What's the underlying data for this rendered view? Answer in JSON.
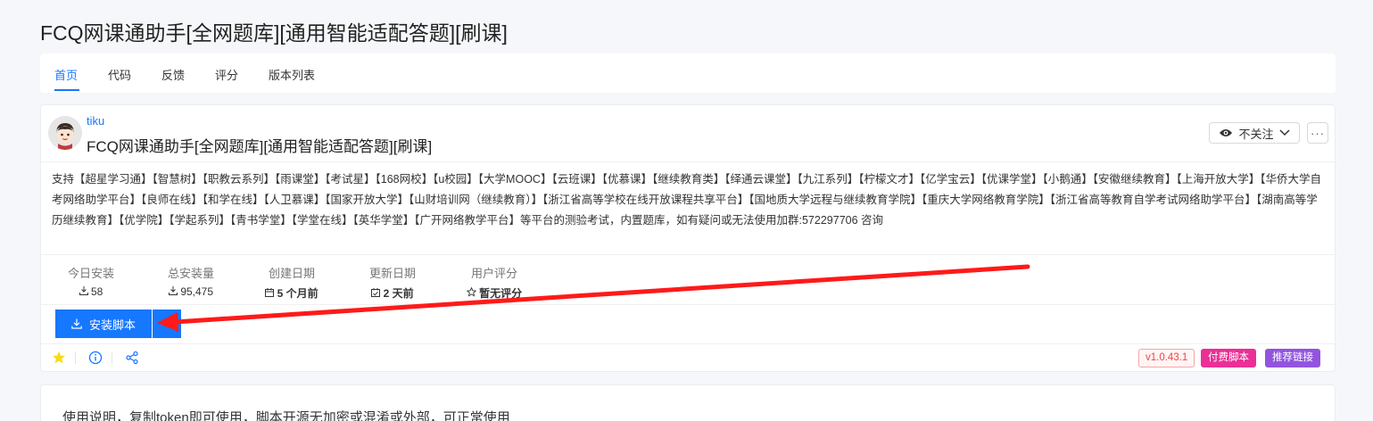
{
  "page": {
    "title": "FCQ网课通助手[全网题库][通用智能适配答题][刷课]"
  },
  "tabs": [
    {
      "label": "首页",
      "active": true
    },
    {
      "label": "代码",
      "active": false
    },
    {
      "label": "反馈",
      "active": false
    },
    {
      "label": "评分",
      "active": false
    },
    {
      "label": "版本列表",
      "active": false
    }
  ],
  "script": {
    "author": "tiku",
    "name": "FCQ网课通助手[全网题库][通用智能适配答题][刷课]",
    "description": "支持【超星学习通】【智慧树】【职教云系列】【雨课堂】【考试星】【168网校】【u校园】【大学MOOC】【云班课】【优慕课】【继续教育类】【绎通云课堂】【九江系列】【柠檬文才】【亿学宝云】【优课学堂】【小鹅通】【安徽继续教育】【上海开放大学】【华侨大学自考网络助学平台】【良师在线】【和学在线】【人卫慕课】【国家开放大学】【山财培训网（继续教育）】【浙江省高等学校在线开放课程共享平台】【国地质大学远程与继续教育学院】【重庆大学网络教育学院】【浙江省高等教育自学考试网络助学平台】【湖南高等学历继续教育】【优学院】【学起系列】【青书学堂】【学堂在线】【英华学堂】【广开网络教学平台】等平台的测验考试，内置题库，如有疑问或无法使用加群:572297706 咨询"
  },
  "header_actions": {
    "follow_label": "不关注",
    "more_label": "···"
  },
  "stats": [
    {
      "label": "今日安装",
      "icon": "download-icon",
      "value": "58"
    },
    {
      "label": "总安装量",
      "icon": "download-icon",
      "value": "95,475"
    },
    {
      "label": "创建日期",
      "icon": "calendar-icon",
      "value": "5 个月前"
    },
    {
      "label": "更新日期",
      "icon": "calendar-check-icon",
      "value": "2 天前"
    },
    {
      "label": "用户评分",
      "icon": "star-outline-icon",
      "value": "暂无评分"
    }
  ],
  "install": {
    "label": "安装脚本"
  },
  "tags": {
    "version": "v1.0.43.1",
    "paid": "付费脚本",
    "recommend": "推荐链接"
  },
  "usage": {
    "text": "使用说明，复制token即可使用，脚本开源无加密或混淆或外部，可正常使用"
  },
  "colors": {
    "accent": "#1677ff",
    "annotation_arrow": "#ff1a1a",
    "star": "#fadb14",
    "paid": "#eb2f96",
    "recommend": "#9254de"
  }
}
